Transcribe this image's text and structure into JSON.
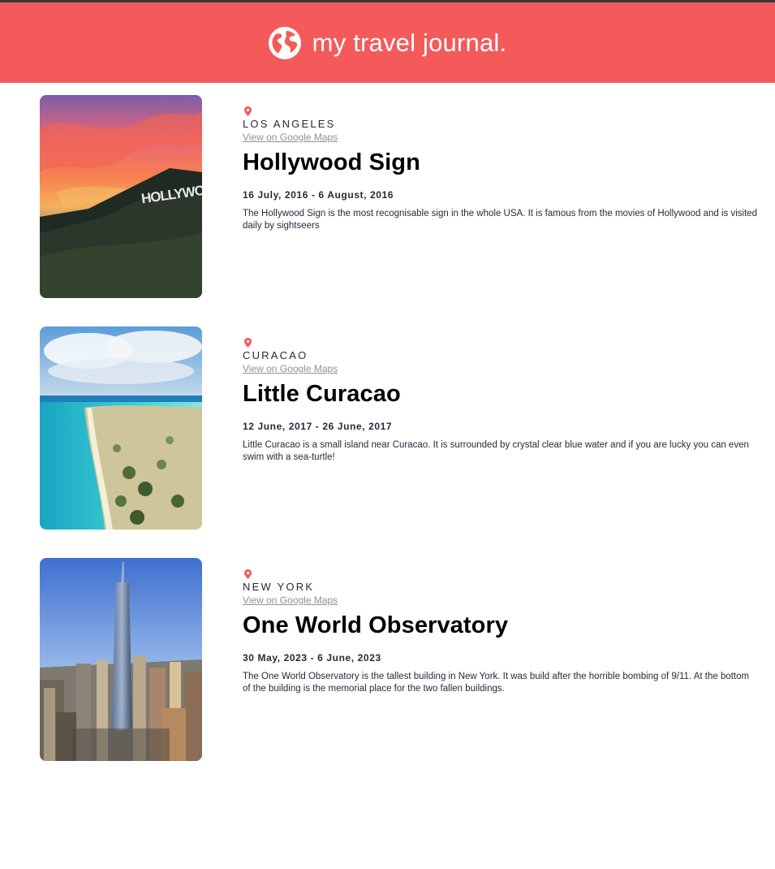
{
  "header": {
    "title": "my travel journal.",
    "icon": "globe-icon",
    "background": "#f55a5a"
  },
  "entries": [
    {
      "location": "LOS ANGELES",
      "maps_link": "View on Google Maps",
      "title": "Hollywood Sign",
      "dates": "16 July, 2016 - 6 August, 2016",
      "description": "The Hollywood Sign is the most recognisable sign in the whole USA. It is famous from the movies of Hollywood and is visited daily by sightseers",
      "image": "Hollywood sign on hillside at sunset",
      "image_text": "HOLLYWOOD"
    },
    {
      "location": "CURACAO",
      "maps_link": "View on Google Maps",
      "title": "Little Curacao",
      "dates": "12 June, 2017 - 26 June, 2017",
      "description": "Little Curacao is a small island near Curacao. It is surrounded by crystal clear blue water and if you are lucky you can even swim with a sea-turtle!",
      "image": "aerial view of small island with turquoise water"
    },
    {
      "location": "NEW YORK",
      "maps_link": "View on Google Maps",
      "title": "One World Observatory",
      "dates": "30 May, 2023 - 6 June, 2023",
      "description": "The One World Observatory is the tallest building in New York. It was build after the horrible bombing of 9/11. At the bottom of the building is the memorial place for the two fallen buildings.",
      "image": "One World Trade Center skyscraper above Manhattan"
    }
  ],
  "colors": {
    "accent": "#f55a5a",
    "pin": "#f55a5a",
    "link": "#918e9b",
    "text": "#2b283a"
  }
}
